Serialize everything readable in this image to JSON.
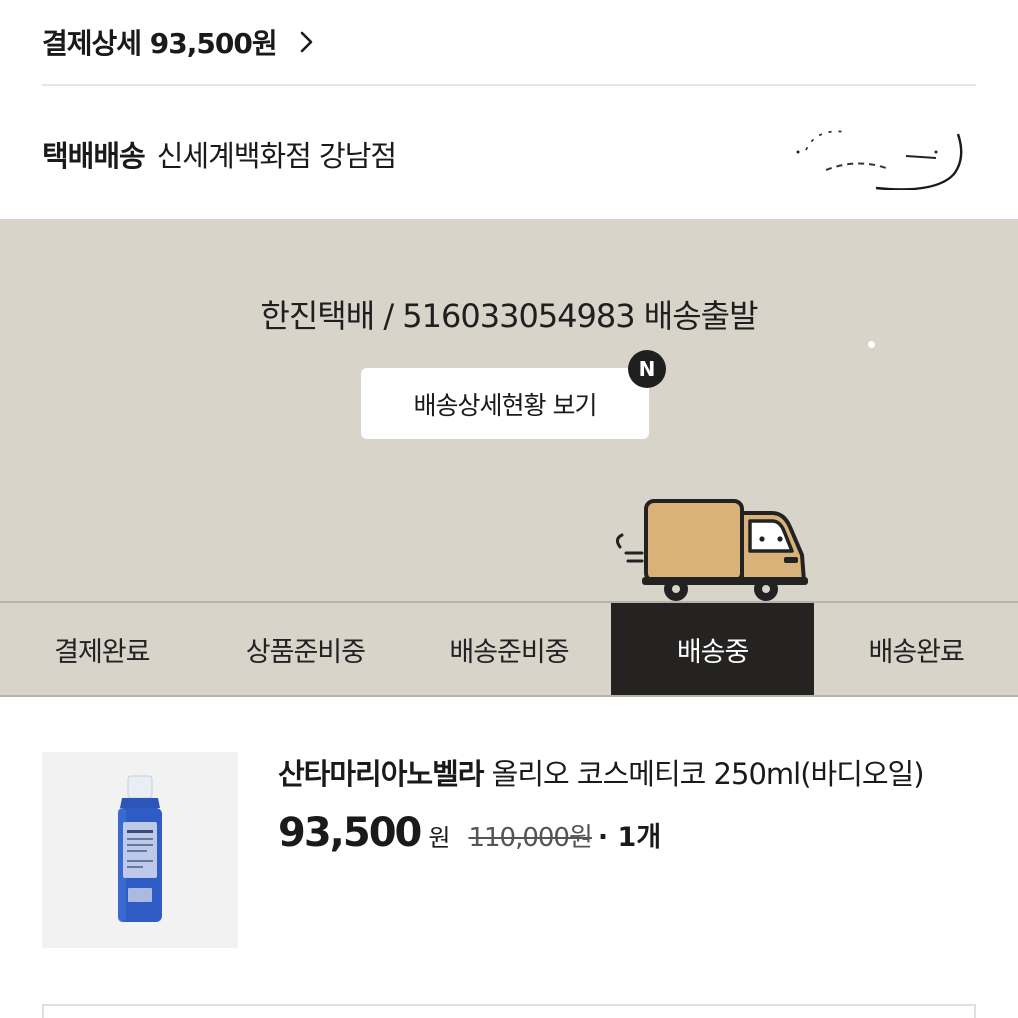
{
  "payment": {
    "label": "결제상세 93,500원",
    "chevron_icon": "chevron-right-icon"
  },
  "delivery": {
    "type": "택배배송",
    "store": "신세계백화점 강남점"
  },
  "tracking": {
    "line": "한진택배 / 516033054983 배송출발",
    "detail_button": "배송상세현황 보기",
    "new_badge": "N",
    "truck_icon": "delivery-truck-icon"
  },
  "steps": [
    {
      "label": "결제완료",
      "active": false
    },
    {
      "label": "상품준비중",
      "active": false
    },
    {
      "label": "배송준비중",
      "active": false
    },
    {
      "label": "배송중",
      "active": true
    },
    {
      "label": "배송완료",
      "active": false
    }
  ],
  "product": {
    "brand": "산타마리아노벨라",
    "name": " 올리오 코스메티코 250ml(바디오일)",
    "price": "93,500",
    "won": "원",
    "original_price": "110,000원",
    "quantity": "· 1개"
  },
  "colors": {
    "panel_bg": "#d8d4ca",
    "active_step": "#242321",
    "truck_body": "#d9b27a"
  }
}
